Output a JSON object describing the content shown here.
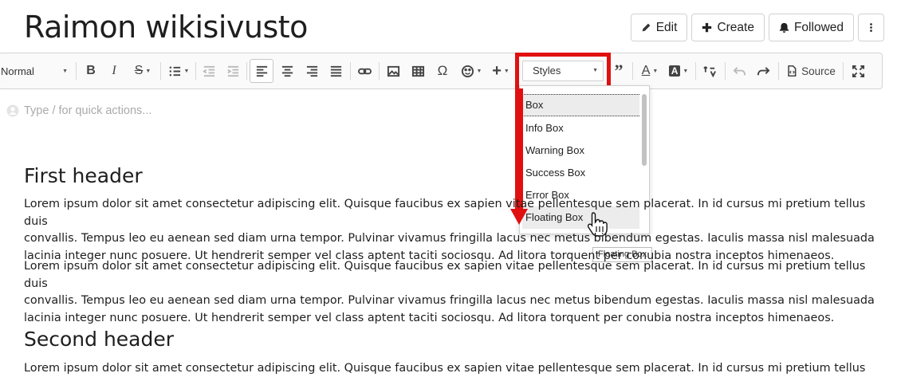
{
  "page": {
    "title": "Raimon wikisivusto"
  },
  "actions": {
    "edit": "Edit",
    "create": "Create",
    "followed": "Followed"
  },
  "toolbar": {
    "format_value": "Normal",
    "styles_value": "Styles",
    "source_label": "Source",
    "buttons": [
      "bold",
      "italic",
      "strikethrough",
      "list",
      "outdent",
      "indent",
      "align-left",
      "align-center",
      "align-right",
      "justify",
      "link",
      "image",
      "table",
      "special-character",
      "emoji",
      "insert",
      "blockquote",
      "font-color",
      "background-color",
      "direction",
      "undo",
      "redo",
      "source",
      "fullscreen"
    ]
  },
  "styles_dropdown": {
    "items": [
      "Box",
      "Info Box",
      "Warning Box",
      "Success Box",
      "Error Box",
      "Floating Box"
    ],
    "selected": "Box",
    "hovered": "Floating Box"
  },
  "tooltip": "Floating Box",
  "editor": {
    "placeholder": "Type / for quick actions...",
    "sections": [
      {
        "header": "First header",
        "paragraphs": [
          [
            "Lorem ipsum dolor sit amet consectetur adipiscing elit. Quisque faucibus ex sapien vitae pellentesque sem placerat. In id cursus mi pretium tellus duis",
            "convallis. Tempus leo eu aenean sed diam urna tempor. Pulvinar vivamus fringilla lacus nec metus bibendum egestas. Iaculis massa nisl malesuada",
            "lacinia integer nunc posuere. Ut hendrerit semper vel class aptent taciti sociosqu. Ad litora torquent per conubia nostra inceptos himenaeos."
          ],
          [
            "Lorem ipsum dolor sit amet consectetur adipiscing elit. Quisque faucibus ex sapien vitae pellentesque sem placerat. In id cursus mi pretium tellus duis",
            "convallis. Tempus leo eu aenean sed diam urna tempor. Pulvinar vivamus fringilla lacus nec metus bibendum egestas. Iaculis massa nisl malesuada",
            "lacinia integer nunc posuere. Ut hendrerit semper vel class aptent taciti sociosqu. Ad litora torquent per conubia nostra inceptos himenaeos."
          ]
        ]
      },
      {
        "header": "Second header",
        "paragraphs": [
          [
            "Lorem ipsum dolor sit amet consectetur adipiscing elit. Quisque faucibus ex sapien vitae pellentesque sem placerat. In id cursus mi pretium tellus duis"
          ]
        ]
      }
    ]
  },
  "colors": {
    "highlight": "#e01010",
    "toolbar_bg": "#fafafa",
    "border": "#d4d4d4"
  }
}
